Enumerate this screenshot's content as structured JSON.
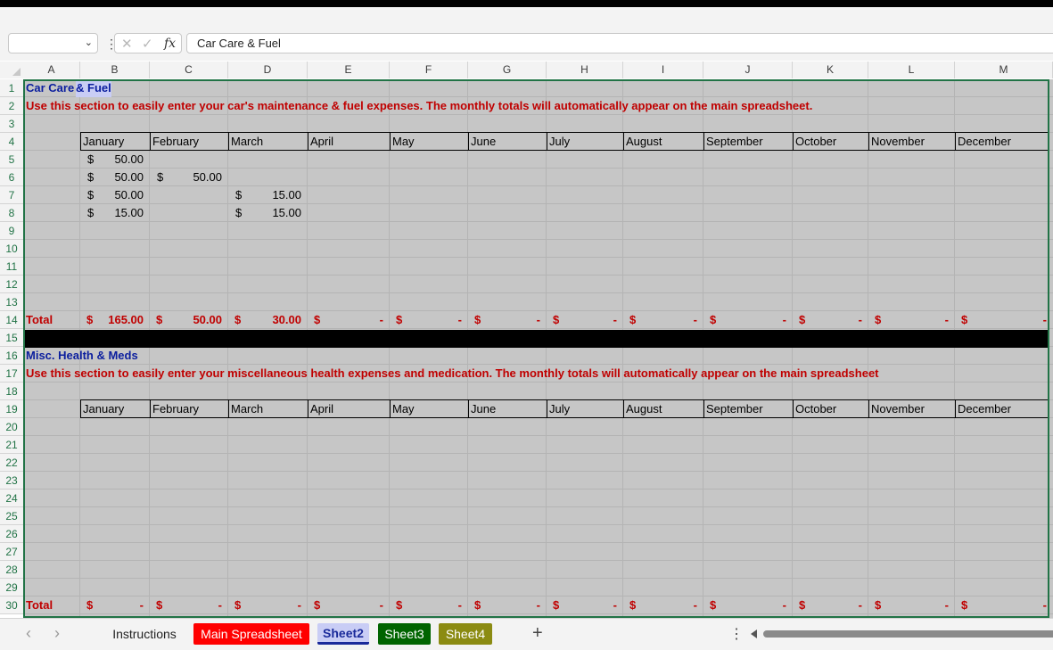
{
  "formula_bar": {
    "name_box": "",
    "content": "Car Care & Fuel"
  },
  "columns": [
    "A",
    "B",
    "C",
    "D",
    "E",
    "F",
    "G",
    "H",
    "I",
    "J",
    "K",
    "L",
    "M"
  ],
  "rows": [
    "1",
    "2",
    "3",
    "4",
    "5",
    "6",
    "7",
    "8",
    "9",
    "10",
    "11",
    "12",
    "13",
    "14",
    "15",
    "16",
    "17",
    "18",
    "19",
    "20",
    "21",
    "22",
    "23",
    "24",
    "25",
    "26",
    "27",
    "28",
    "29",
    "30"
  ],
  "months": [
    "January",
    "February",
    "March",
    "April",
    "May",
    "June",
    "July",
    "August",
    "September",
    "October",
    "November",
    "December"
  ],
  "section1": {
    "title_part1": "Car Care",
    "title_part2": " & Fuel",
    "description": "Use this section to easily enter your car's maintenance & fuel expenses. The monthly totals will automatically appear on the main spreadsheet.",
    "entries": [
      {
        "col": "B",
        "row": 5,
        "currency": "$",
        "amount": "50.00"
      },
      {
        "col": "B",
        "row": 6,
        "currency": "$",
        "amount": "50.00"
      },
      {
        "col": "C",
        "row": 6,
        "currency": "$",
        "amount": "50.00"
      },
      {
        "col": "B",
        "row": 7,
        "currency": "$",
        "amount": "50.00"
      },
      {
        "col": "D",
        "row": 7,
        "currency": "$",
        "amount": "15.00"
      },
      {
        "col": "B",
        "row": 8,
        "currency": "$",
        "amount": "15.00"
      },
      {
        "col": "D",
        "row": 8,
        "currency": "$",
        "amount": "15.00"
      }
    ],
    "total_label": "Total",
    "totals": [
      {
        "currency": "$",
        "amount": "165.00"
      },
      {
        "currency": "$",
        "amount": "50.00"
      },
      {
        "currency": "$",
        "amount": "30.00"
      },
      {
        "currency": "$",
        "amount": "-"
      },
      {
        "currency": "$",
        "amount": "-"
      },
      {
        "currency": "$",
        "amount": "-"
      },
      {
        "currency": "$",
        "amount": "-"
      },
      {
        "currency": "$",
        "amount": "-"
      },
      {
        "currency": "$",
        "amount": "-"
      },
      {
        "currency": "$",
        "amount": "-"
      },
      {
        "currency": "$",
        "amount": "-"
      },
      {
        "currency": "$",
        "amount": "-"
      }
    ]
  },
  "section2": {
    "title": "Misc. Health & Meds",
    "description": "Use this section to easily enter your miscellaneous health expenses and medication. The monthly totals will automatically appear on the main spreadsheet",
    "total_label": "Total",
    "totals": [
      {
        "currency": "$",
        "amount": "-"
      },
      {
        "currency": "$",
        "amount": "-"
      },
      {
        "currency": "$",
        "amount": "-"
      },
      {
        "currency": "$",
        "amount": "-"
      },
      {
        "currency": "$",
        "amount": "-"
      },
      {
        "currency": "$",
        "amount": "-"
      },
      {
        "currency": "$",
        "amount": "-"
      },
      {
        "currency": "$",
        "amount": "-"
      },
      {
        "currency": "$",
        "amount": "-"
      },
      {
        "currency": "$",
        "amount": "-"
      },
      {
        "currency": "$",
        "amount": "-"
      },
      {
        "currency": "$",
        "amount": "-"
      }
    ]
  },
  "sheet_tabs": [
    {
      "label": "Instructions",
      "bg": "#f3f3f3",
      "fg": "#222222"
    },
    {
      "label": "Main Spreadsheet",
      "bg": "#ff0000",
      "fg": "#ffffff"
    },
    {
      "label": "Sheet2",
      "bg": "#c9cdf5",
      "fg": "#1a2a9a",
      "active": true
    },
    {
      "label": "Sheet3",
      "bg": "#006400",
      "fg": "#ffffff"
    },
    {
      "label": "Sheet4",
      "bg": "#8b8b12",
      "fg": "#ffffff"
    }
  ],
  "add_sheet": "+",
  "colors": {
    "accent": "#217346",
    "title_blue": "#0b1e9e",
    "total_red": "#c00000",
    "grid_bg": "#c6c6c6"
  }
}
